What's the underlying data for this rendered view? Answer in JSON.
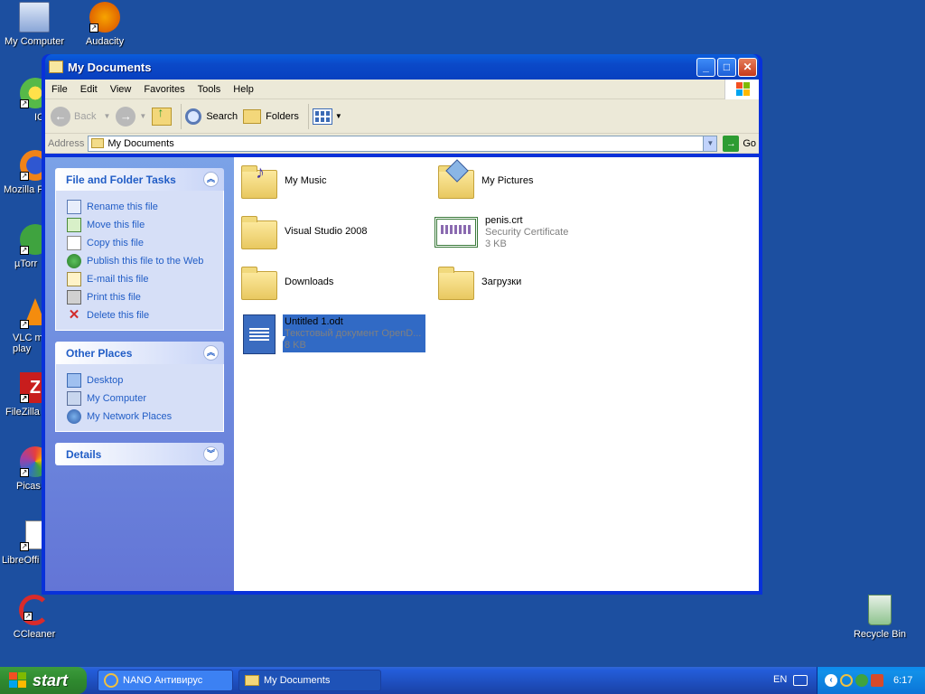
{
  "desktop": {
    "icons": [
      {
        "label": "My Computer"
      },
      {
        "label": "Audacity"
      },
      {
        "label": "ICC"
      },
      {
        "label": "Mozilla F"
      },
      {
        "label": "µTorr"
      },
      {
        "label": "VLC m\nplay"
      },
      {
        "label": "FileZilla"
      },
      {
        "label": "Picas"
      },
      {
        "label": "LibreOffi"
      },
      {
        "label": "CCleaner"
      },
      {
        "label": "Recycle Bin"
      }
    ]
  },
  "window": {
    "title": "My Documents",
    "menu": [
      "File",
      "Edit",
      "View",
      "Favorites",
      "Tools",
      "Help"
    ],
    "toolbar": {
      "back": "Back",
      "search": "Search",
      "folders": "Folders"
    },
    "address": {
      "label": "Address",
      "value": "My Documents",
      "go": "Go"
    },
    "taskpane": {
      "file_tasks": {
        "title": "File and Folder Tasks",
        "items": [
          "Rename this file",
          "Move this file",
          "Copy this file",
          "Publish this file to the Web",
          "E-mail this file",
          "Print this file",
          "Delete this file"
        ]
      },
      "other_places": {
        "title": "Other Places",
        "items": [
          "Desktop",
          "My Computer",
          "My Network Places"
        ]
      },
      "details": {
        "title": "Details"
      }
    },
    "files": [
      {
        "name": "My Music",
        "sub1": "",
        "sub2": ""
      },
      {
        "name": "My Pictures",
        "sub1": "",
        "sub2": ""
      },
      {
        "name": "Visual Studio 2008",
        "sub1": "",
        "sub2": ""
      },
      {
        "name": "penis.crt",
        "sub1": "Security Certificate",
        "sub2": "3 KB"
      },
      {
        "name": "Downloads",
        "sub1": "",
        "sub2": ""
      },
      {
        "name": "Загрузки",
        "sub1": "",
        "sub2": ""
      },
      {
        "name": "Untitled 1.odt",
        "sub1": "Текстовый документ OpenD...",
        "sub2": "8 KB"
      }
    ]
  },
  "taskbar": {
    "start": "start",
    "tasks": [
      {
        "label": "NANO Антивирус"
      },
      {
        "label": "My Documents"
      }
    ],
    "lang": "EN",
    "clock": "6:17"
  }
}
